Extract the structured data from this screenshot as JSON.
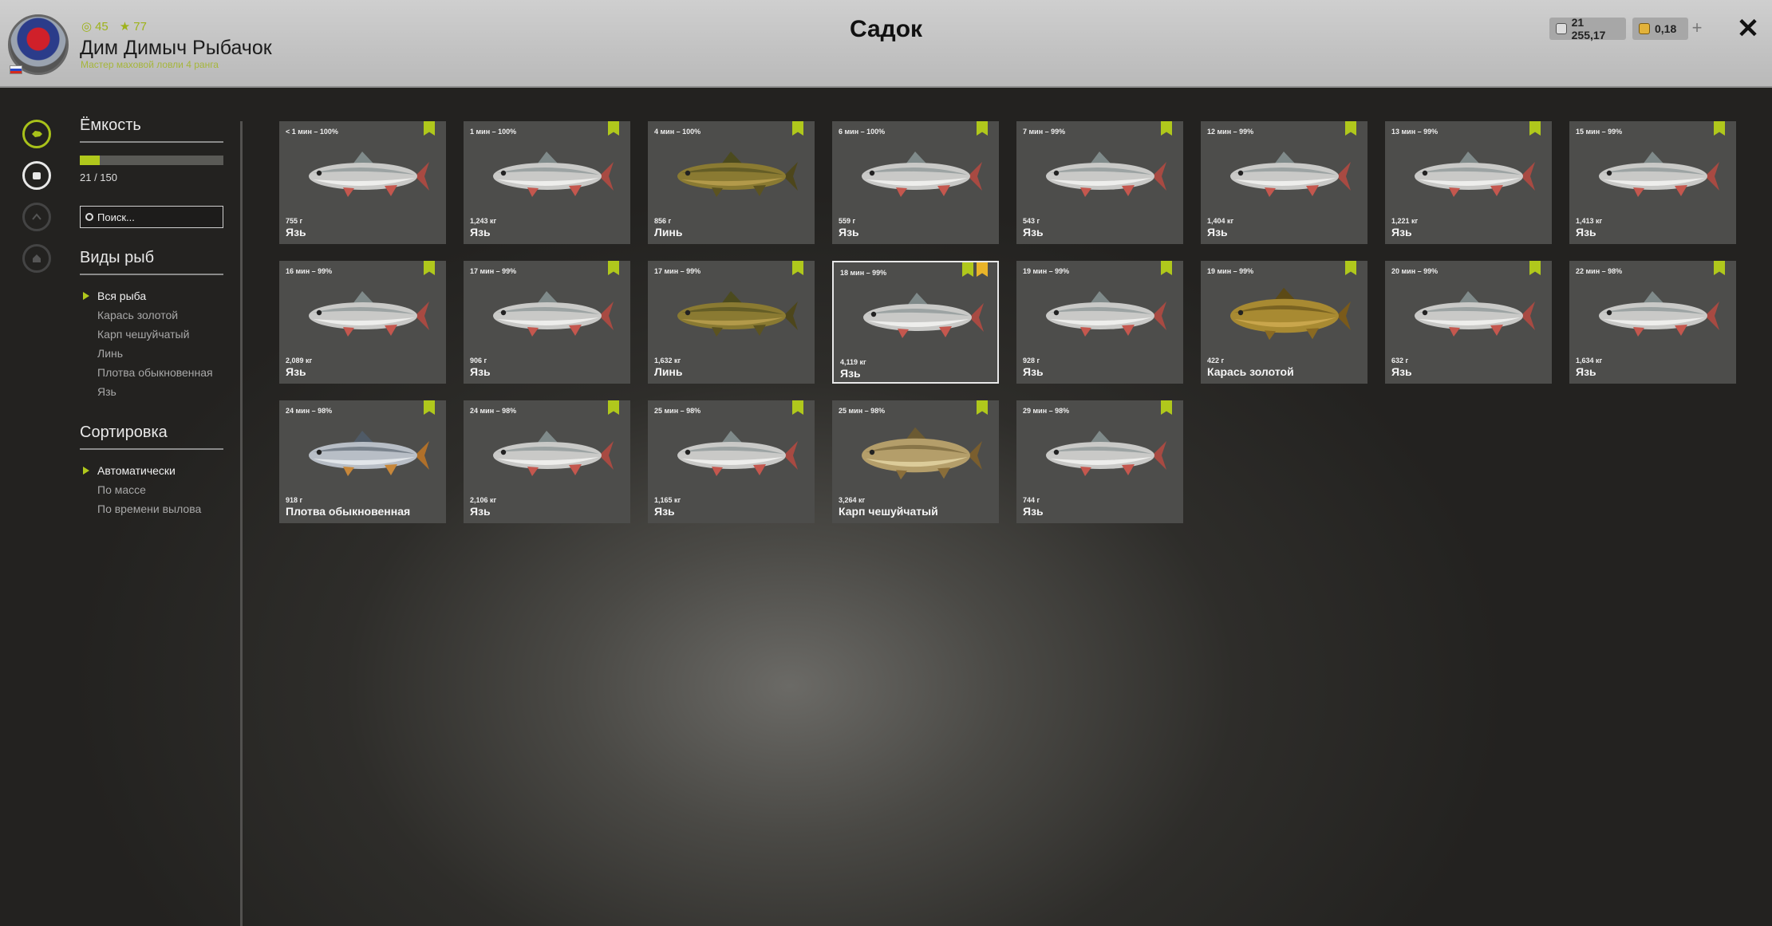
{
  "header": {
    "title": "Садок",
    "player_name": "Дим Димыч Рыбачок",
    "player_rank": "Мастер маховой ловли 4 ранга",
    "level": "45",
    "stars": "77",
    "silver": "21 255,17",
    "gold": "0,18",
    "plus": "+",
    "close": "✕"
  },
  "panel": {
    "capacity_title": "Ёмкость",
    "capacity_text": "21 / 150",
    "capacity_fraction": 0.14,
    "search_placeholder": "Поиск...",
    "species_title": "Виды рыб",
    "species": [
      "Вся рыба",
      "Карась золотой",
      "Карп чешуйчатый",
      "Линь",
      "Плотва обыкновенная",
      "Язь"
    ],
    "sort_title": "Сортировка",
    "sorts": [
      "Автоматически",
      "По массе",
      "По времени вылова"
    ]
  },
  "fish": [
    {
      "time": "< 1 мин – 100%",
      "mass": "755 г",
      "name": "Язь",
      "kind": "ide"
    },
    {
      "time": "1 мин – 100%",
      "mass": "1,243 кг",
      "name": "Язь",
      "kind": "ide"
    },
    {
      "time": "4 мин – 100%",
      "mass": "856 г",
      "name": "Линь",
      "kind": "tench"
    },
    {
      "time": "6 мин – 100%",
      "mass": "559 г",
      "name": "Язь",
      "kind": "ide"
    },
    {
      "time": "7 мин – 99%",
      "mass": "543 г",
      "name": "Язь",
      "kind": "ide"
    },
    {
      "time": "12 мин – 99%",
      "mass": "1,404 кг",
      "name": "Язь",
      "kind": "ide"
    },
    {
      "time": "13 мин – 99%",
      "mass": "1,221 кг",
      "name": "Язь",
      "kind": "ide"
    },
    {
      "time": "15 мин – 99%",
      "mass": "1,413 кг",
      "name": "Язь",
      "kind": "ide"
    },
    {
      "time": "16 мин – 99%",
      "mass": "2,089 кг",
      "name": "Язь",
      "kind": "ide"
    },
    {
      "time": "17 мин – 99%",
      "mass": "906 г",
      "name": "Язь",
      "kind": "ide"
    },
    {
      "time": "17 мин – 99%",
      "mass": "1,632 кг",
      "name": "Линь",
      "kind": "tench"
    },
    {
      "time": "18 мин – 99%",
      "mass": "4,119 кг",
      "name": "Язь",
      "kind": "ide",
      "selected": true,
      "star": true
    },
    {
      "time": "19 мин – 99%",
      "mass": "928 г",
      "name": "Язь",
      "kind": "ide"
    },
    {
      "time": "19 мин – 99%",
      "mass": "422 г",
      "name": "Карась золотой",
      "kind": "crucian"
    },
    {
      "time": "20 мин – 99%",
      "mass": "632 г",
      "name": "Язь",
      "kind": "ide"
    },
    {
      "time": "22 мин – 98%",
      "mass": "1,634 кг",
      "name": "Язь",
      "kind": "ide"
    },
    {
      "time": "24 мин – 98%",
      "mass": "918 г",
      "name": "Плотва обыкновенная",
      "kind": "roach"
    },
    {
      "time": "24 мин – 98%",
      "mass": "2,106 кг",
      "name": "Язь",
      "kind": "ide"
    },
    {
      "time": "25 мин – 98%",
      "mass": "1,165 кг",
      "name": "Язь",
      "kind": "ide"
    },
    {
      "time": "25 мин – 98%",
      "mass": "3,264 кг",
      "name": "Карп чешуйчатый",
      "kind": "carp"
    },
    {
      "time": "29 мин – 98%",
      "mass": "744 г",
      "name": "Язь",
      "kind": "ide"
    }
  ],
  "colors": {
    "accent": "#b0c81c",
    "star": "#e9b429"
  }
}
